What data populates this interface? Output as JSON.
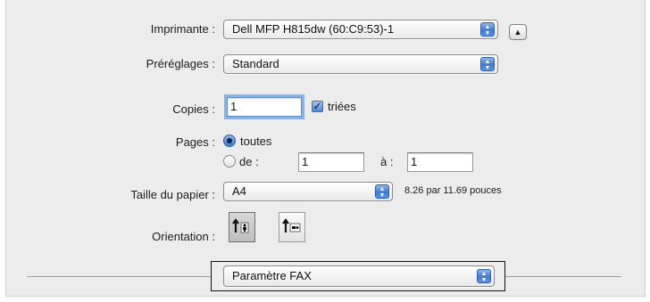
{
  "printer": {
    "label": "Imprimante :",
    "value": "Dell MFP H815dw (60:C9:53)-1",
    "expand_icon": "triangle-up-icon"
  },
  "presets": {
    "label": "Préréglages :",
    "value": "Standard"
  },
  "copies": {
    "label": "Copies :",
    "value": "1",
    "collated_label": "triées",
    "collated_checked": true
  },
  "pages": {
    "label": "Pages :",
    "all_label": "toutes",
    "range_label": "de :",
    "from_value": "1",
    "to_label": "à :",
    "to_value": "1",
    "selected": "all"
  },
  "paper": {
    "label": "Taille du papier :",
    "value": "A4",
    "dimensions": "8.26 par 11.69 pouces"
  },
  "orientation": {
    "label": "Orientation :",
    "portrait_icon": "portrait-orientation-icon",
    "landscape_icon": "landscape-orientation-icon",
    "selected": "portrait"
  },
  "section": {
    "value": "Paramètre FAX"
  },
  "colors": {
    "accent": "#3e7bd1",
    "panel": "#ececec"
  }
}
